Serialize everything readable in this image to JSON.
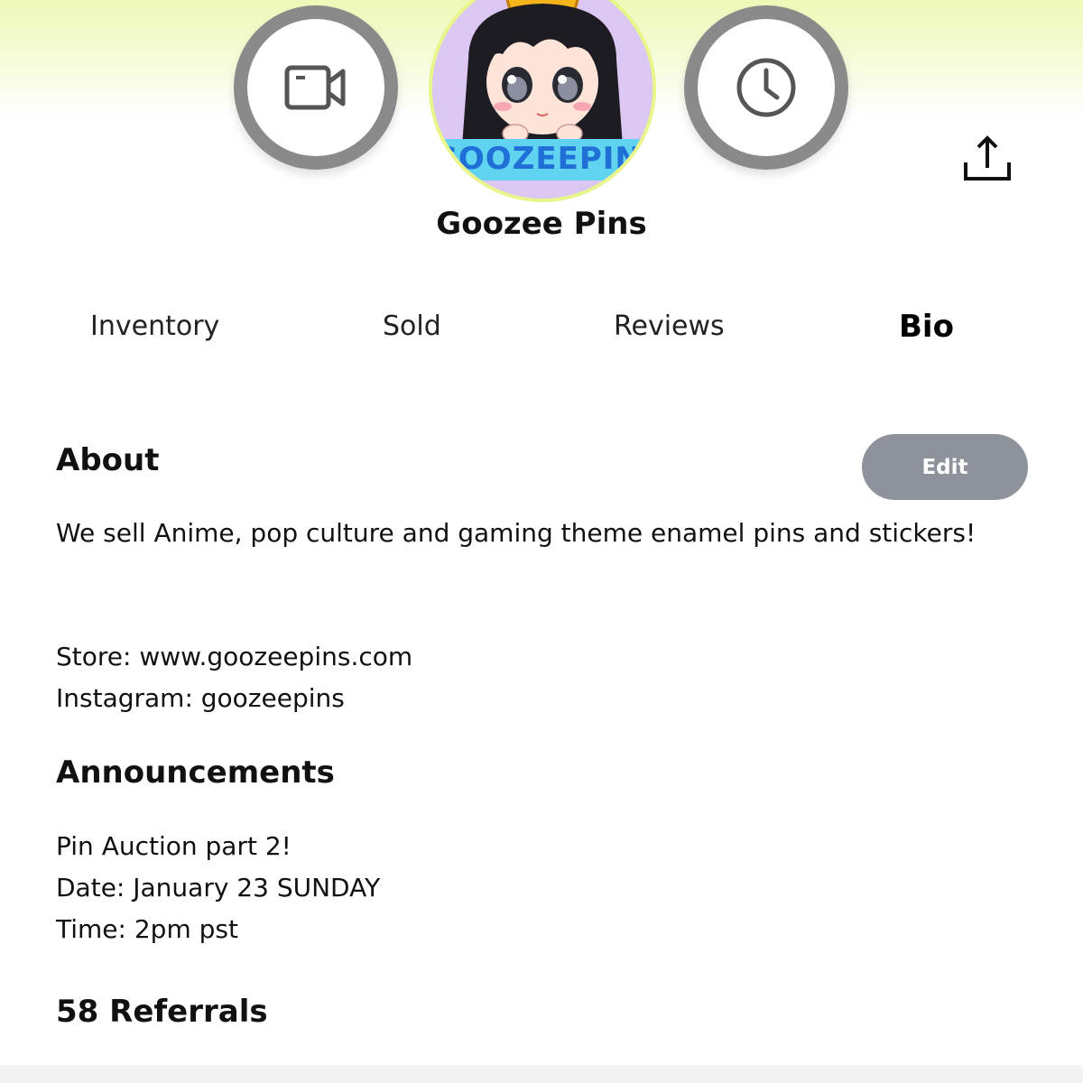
{
  "profile": {
    "name": "Goozee Pins",
    "avatar_banner_text": "GOOZEEPINS"
  },
  "actions": {
    "video_icon": "video-camera-icon",
    "clock_icon": "clock-icon",
    "share_icon": "share-upload-icon"
  },
  "tabs": [
    {
      "label": "Inventory",
      "active": false
    },
    {
      "label": "Sold",
      "active": false
    },
    {
      "label": "Reviews",
      "active": false
    },
    {
      "label": "Bio",
      "active": true
    }
  ],
  "about": {
    "title": "About",
    "edit_label": "Edit",
    "description": "We sell Anime, pop culture and gaming theme enamel pins and stickers!",
    "store_line": "Store: www.goozeepins.com",
    "instagram_line": "Instagram: goozeepins"
  },
  "announcements": {
    "title": "Announcements",
    "lines": [
      "Pin Auction part 2!",
      "Date: January 23 SUNDAY",
      "Time: 2pm pst"
    ]
  },
  "referrals": {
    "label": "58 Referrals"
  },
  "colors": {
    "accent_top": "#eef9b8",
    "edit_button": "#8e929b",
    "avatar_ring": "#e8f58a",
    "circle_ring": "#8a8a8a"
  }
}
